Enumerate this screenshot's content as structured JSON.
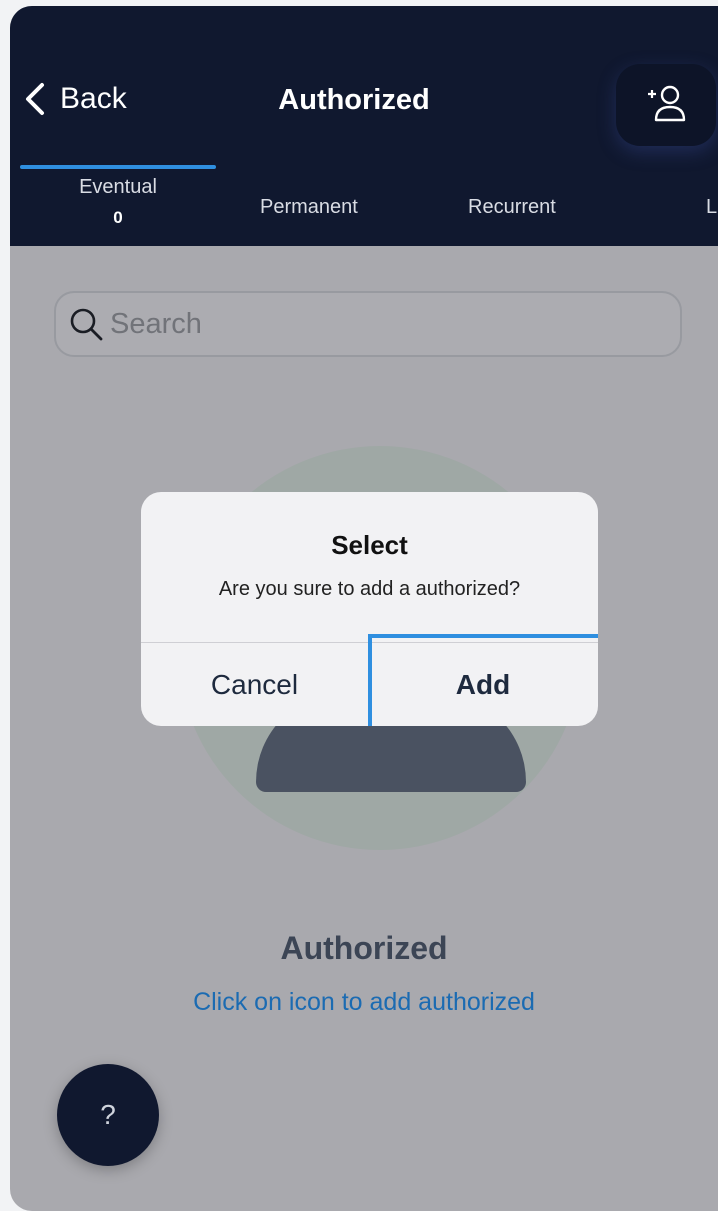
{
  "header": {
    "back_label": "Back",
    "title": "Authorized",
    "add_icon": "add-user-icon"
  },
  "tabs": [
    {
      "label": "Eventual",
      "count": "0",
      "active": true
    },
    {
      "label": "Permanent"
    },
    {
      "label": "Recurrent"
    },
    {
      "label": "L"
    }
  ],
  "search": {
    "placeholder": "Search"
  },
  "empty_state": {
    "title": "Authorized",
    "subtitle": "Click on icon to add authorized"
  },
  "dialog": {
    "title": "Select",
    "message": "Are you sure to add a authorized?",
    "cancel_label": "Cancel",
    "add_label": "Add"
  },
  "help": {
    "label": "?"
  },
  "colors": {
    "header_bg": "#10182f",
    "accent": "#2f8fe0",
    "link": "#1b6bb2",
    "overlay_bg": "#a9a9ae"
  }
}
